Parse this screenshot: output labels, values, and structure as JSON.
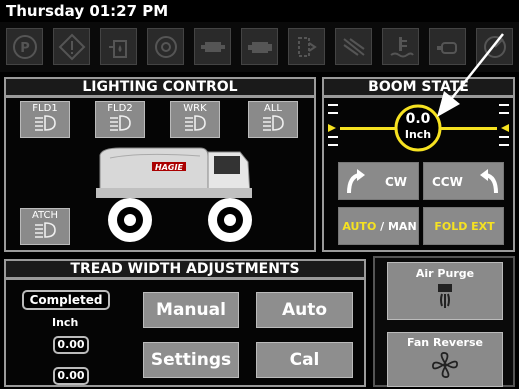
{
  "header": {
    "clock": "Thursday 01:27 PM"
  },
  "warning_icons": [
    "park-brake-icon",
    "warning-diamond-icon",
    "fuel-water-icon",
    "oil-pressure-icon",
    "transmission-icon",
    "engine-icon",
    "coolant-icon",
    "exhaust-filter-icon",
    "coolant-level-icon",
    "engine-check-icon",
    "turbo-icon"
  ],
  "lighting": {
    "title": "LIGHTING CONTROL",
    "buttons": [
      {
        "label": "FLD1"
      },
      {
        "label": "FLD2"
      },
      {
        "label": "WRK"
      },
      {
        "label": "ALL"
      },
      {
        "label": "ATCH"
      }
    ],
    "sprayer_logo": "HAGIE"
  },
  "boom": {
    "title": "BOOM STATE",
    "value": "0.0",
    "unit": "Inch",
    "cw_label": "CW",
    "ccw_label": "CCW",
    "auto_label": "AUTO",
    "separator": " / ",
    "man_label": "MAN",
    "fold_label": "FOLD EXT",
    "colors": {
      "accent": "#f6e221"
    }
  },
  "tread": {
    "title": "TREAD WIDTH ADJUSTMENTS",
    "status": "Completed",
    "unit": "Inch",
    "value1": "0.00",
    "value2": "0.00",
    "manual_label": "Manual",
    "auto_label": "Auto",
    "settings_label": "Settings",
    "cal_label": "Cal"
  },
  "side_buttons": {
    "air_purge": "Air Purge",
    "fan_reverse": "Fan Reverse"
  }
}
